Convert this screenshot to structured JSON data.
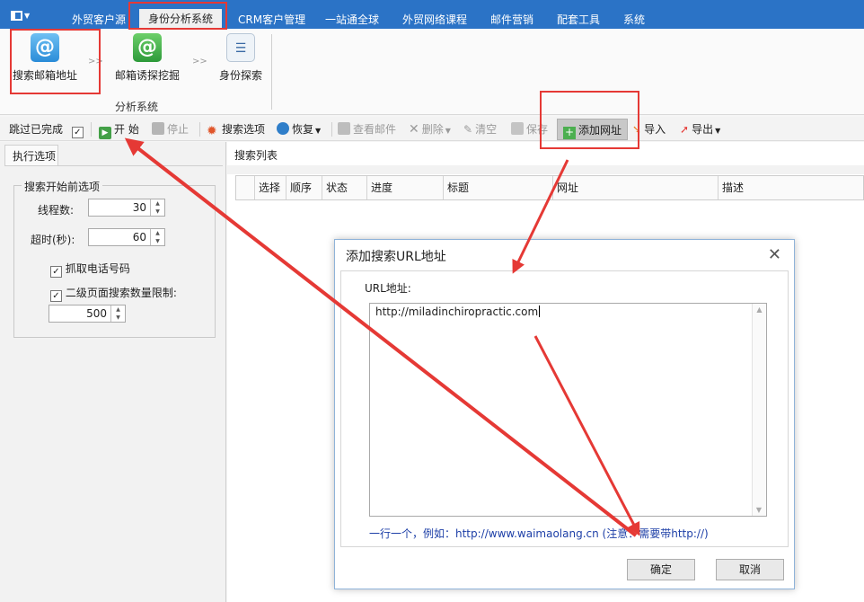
{
  "menu": {
    "tabs": [
      "外贸客户源",
      "身份分析系统",
      "CRM客户管理",
      "一站通全球",
      "外贸网络课程",
      "邮件营销",
      "配套工具",
      "系统"
    ]
  },
  "ribbon": {
    "buttons": [
      "搜索邮箱地址",
      "邮箱诱探挖掘",
      "身份探索"
    ],
    "arrow": ">>",
    "group_label": "分析系统"
  },
  "toolbar": {
    "skip_done_label": "跳过已完成",
    "start": "开 始",
    "stop": "停止",
    "search_options": "搜索选项",
    "restore": "恢复",
    "view_mail": "查看邮件",
    "delete": "删除",
    "clear": "清空",
    "save": "保存",
    "add_url": "添加网址",
    "import": "导入",
    "export": "导出"
  },
  "left_panel": {
    "tab": "执行选项",
    "group_title": "搜索开始前选项",
    "threads_label": "线程数:",
    "threads_value": "30",
    "timeout_label": "超时(秒):",
    "timeout_value": "60",
    "grab_phone_label": "抓取电话号码",
    "limit_label": "二级页面搜索数量限制:",
    "limit_value": "500"
  },
  "search_list": {
    "tab": "搜索列表",
    "columns": [
      "选择",
      "顺序",
      "状态",
      "进度",
      "标题",
      "网址",
      "描述"
    ]
  },
  "dialog": {
    "title": "添加搜索URL地址",
    "url_label": "URL地址:",
    "url_value": "http://miladinchiropractic.com",
    "hint": "一行一个，例如：http://www.waimaolang.cn (注意：需要带http://)",
    "ok": "确定",
    "cancel": "取消"
  },
  "colors": {
    "menubar": "#2b73c6",
    "annotation": "#e53935",
    "hint_text": "#1d3fa7"
  }
}
